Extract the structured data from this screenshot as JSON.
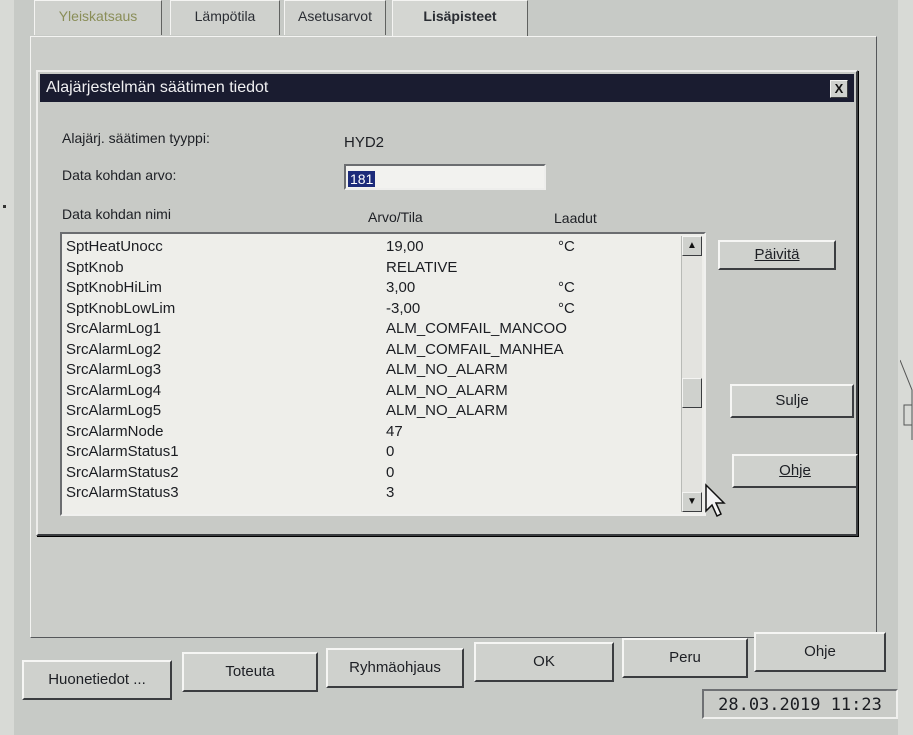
{
  "tabs": [
    {
      "label": "Yleiskatsaus"
    },
    {
      "label": "Lämpötila"
    },
    {
      "label": "Asetusarvot"
    },
    {
      "label": "Lisäpisteet"
    }
  ],
  "dialog": {
    "title": "Alajärjestelmän säätimen tiedot",
    "close_symbol": "X",
    "type_label": "Alajärj. säätimen tyyppi:",
    "type_value": "HYD2",
    "value_label": "Data kohdan arvo:",
    "value_label_accel": "a",
    "value_input": "181",
    "col_name": "Data kohdan nimi",
    "col_value": "Arvo/Tila",
    "col_quality": "Laadut",
    "rows": [
      {
        "name": "SptHeatUnocc",
        "value": "19,00",
        "quality": "°C"
      },
      {
        "name": "SptKnob",
        "value": "RELATIVE",
        "quality": ""
      },
      {
        "name": "SptKnobHiLim",
        "value": "3,00",
        "quality": "°C"
      },
      {
        "name": "SptKnobLowLim",
        "value": "-3,00",
        "quality": "°C"
      },
      {
        "name": "SrcAlarmLog1",
        "value": "ALM_COMFAIL_MANCOO",
        "quality": ""
      },
      {
        "name": "SrcAlarmLog2",
        "value": "ALM_COMFAIL_MANHEA",
        "quality": ""
      },
      {
        "name": "SrcAlarmLog3",
        "value": "ALM_NO_ALARM",
        "quality": ""
      },
      {
        "name": "SrcAlarmLog4",
        "value": "ALM_NO_ALARM",
        "quality": ""
      },
      {
        "name": "SrcAlarmLog5",
        "value": "ALM_NO_ALARM",
        "quality": ""
      },
      {
        "name": "SrcAlarmNode",
        "value": "47",
        "quality": ""
      },
      {
        "name": "SrcAlarmStatus1",
        "value": "0",
        "quality": ""
      },
      {
        "name": "SrcAlarmStatus2",
        "value": "0",
        "quality": ""
      },
      {
        "name": "SrcAlarmStatus3",
        "value": "3",
        "quality": ""
      }
    ],
    "buttons": {
      "refresh": "Päivitä",
      "close": "Sulje",
      "help": "Ohje"
    }
  },
  "footer_buttons": [
    {
      "label": "Huonetiedot ..."
    },
    {
      "label": "Toteuta"
    },
    {
      "label": "Ryhmäohjaus"
    },
    {
      "label": "OK"
    },
    {
      "label": "Peru"
    },
    {
      "label": "Ohje"
    }
  ],
  "datetime": "28.03.2019  11:23",
  "colors": {
    "titlebar": "#1a1c30",
    "selection": "#1c2b7a",
    "face": "#cfd1cd"
  }
}
